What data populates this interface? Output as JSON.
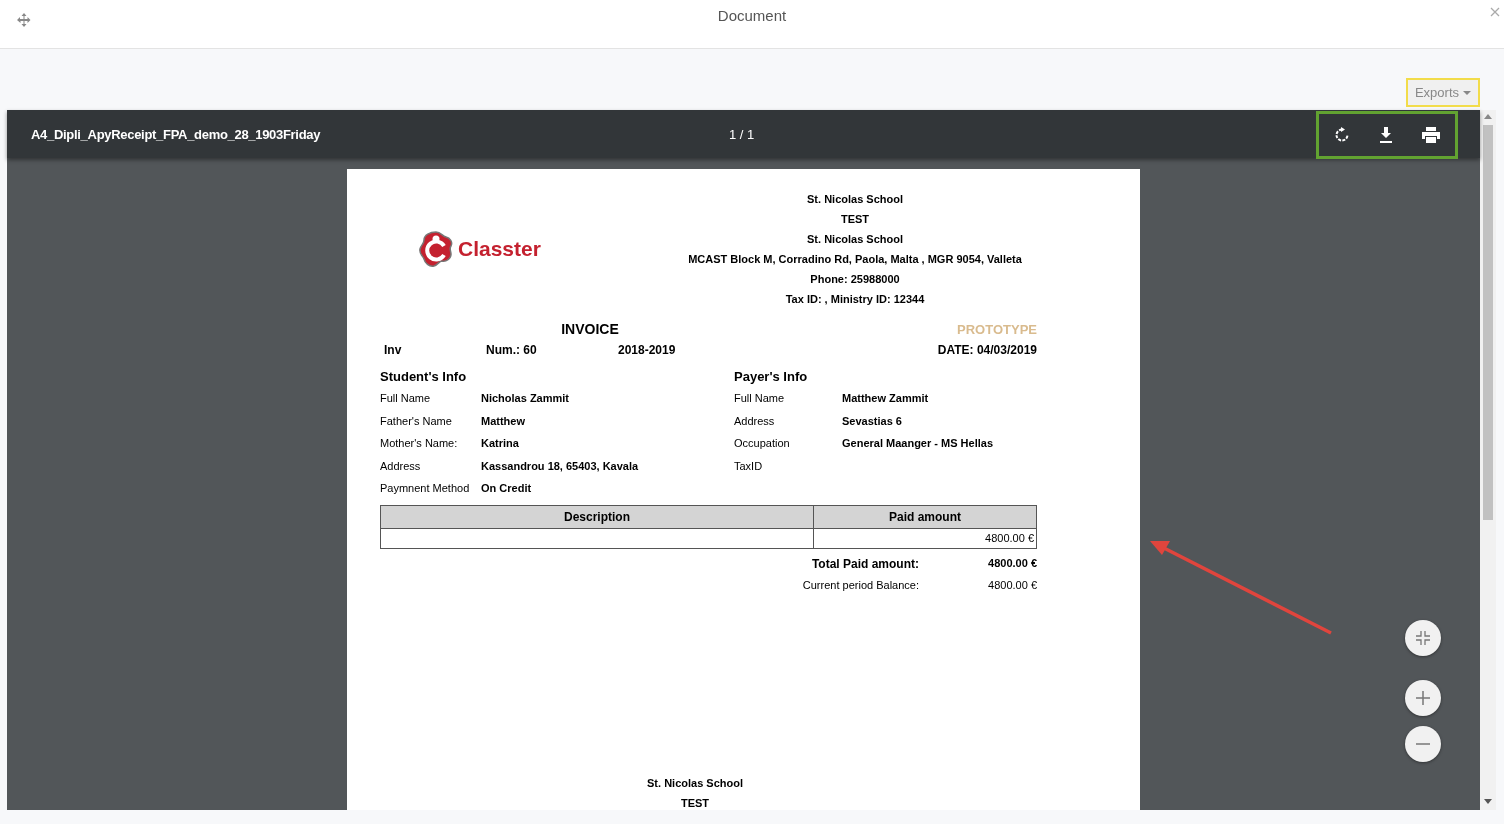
{
  "window": {
    "title": "Document"
  },
  "exports_button": {
    "label": "Exports"
  },
  "viewer": {
    "file_name": "A4_Dipli_ApyReceipt_FPA_demo_28_1903Friday",
    "page_indicator": "1 / 1"
  },
  "document": {
    "logo_text": "Classter",
    "header_lines": [
      "St. Nicolas School",
      "TEST",
      "St. Nicolas School",
      "MCAST Block M, Corradino Rd, Paola, Malta , MGR 9054, Valleta",
      "Phone: 25988000",
      "Tax ID: , Ministry ID: 12344"
    ],
    "title": "INVOICE",
    "watermark": "PROTOTYPE",
    "meta": [
      "Inv",
      "Num.: 60",
      "2018-2019",
      "DATE: 04/03/2019"
    ],
    "student_info": {
      "heading": "Student's Info",
      "fields": [
        {
          "label": "Full Name",
          "value": "Nicholas Zammit"
        },
        {
          "label": "Father's Name",
          "value": "Matthew"
        },
        {
          "label": "Mother's Name:",
          "value": "Katrina"
        },
        {
          "label": "Address",
          "value": "Kassandrou 18, 65403, Kavala"
        },
        {
          "label": "Paymnent Method",
          "value": "On Credit"
        }
      ]
    },
    "payer_info": {
      "heading": "Payer's Info",
      "fields": [
        {
          "label": "Full Name",
          "value": "Matthew Zammit"
        },
        {
          "label": "Address",
          "value": "Sevastias 6"
        },
        {
          "label": "Occupation",
          "value": "General Maanger - MS Hellas"
        },
        {
          "label": "TaxID"
        }
      ]
    },
    "table": {
      "columns": [
        "Description",
        "Paid amount"
      ],
      "rows": [
        [
          "",
          "4800.00 €"
        ]
      ]
    },
    "totals": [
      {
        "kind": "strong",
        "label": "Total Paid amount:",
        "value": "4800.00 €"
      },
      {
        "kind": "plain",
        "label": "Current period Balance:",
        "value": "4800.00 €"
      }
    ],
    "footer_lines": [
      "St. Nicolas School",
      "TEST"
    ]
  }
}
